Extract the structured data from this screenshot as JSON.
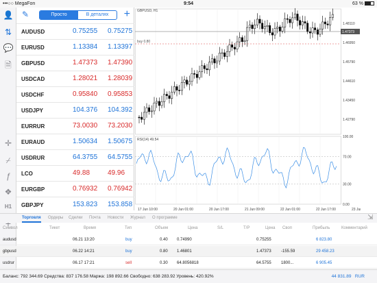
{
  "status": {
    "left": "•••○○ MegaFon",
    "time": "9:54",
    "right": "63 %"
  },
  "quotes": {
    "tabs": {
      "simple": "Просто",
      "detailed": "В деталях"
    },
    "rows": [
      {
        "sym": "AUDUSD",
        "bid": "0.75255",
        "ask": "0.75275",
        "color": "blue"
      },
      {
        "sym": "EURUSD",
        "bid": "1.13384",
        "ask": "1.13397",
        "color": "blue"
      },
      {
        "sym": "GBPUSD",
        "bid": "1.47373",
        "ask": "1.47390",
        "color": "red"
      },
      {
        "sym": "USDCAD",
        "bid": "1.28021",
        "ask": "1.28039",
        "color": "red"
      },
      {
        "sym": "USDCHF",
        "bid": "0.95840",
        "ask": "0.95853",
        "color": "red"
      },
      {
        "sym": "USDJPY",
        "bid": "104.376",
        "ask": "104.392",
        "color": "blue"
      },
      {
        "sym": "EURRUR",
        "bid": "73.0030",
        "ask": "73.2030",
        "color": "red"
      },
      {
        "sym": "EURAUD",
        "bid": "1.50634",
        "ask": "1.50675",
        "color": "blue"
      },
      {
        "sym": "USDRUR",
        "bid": "64.3755",
        "ask": "64.5755",
        "color": "blue"
      },
      {
        "sym": "LCO",
        "bid": "49.88",
        "ask": "49.96",
        "color": "red"
      },
      {
        "sym": "EURGBP",
        "bid": "0.76932",
        "ask": "0.76942",
        "color": "red"
      },
      {
        "sym": "GBPJPY",
        "bid": "153.823",
        "ask": "153.858",
        "color": "blue"
      }
    ]
  },
  "chart": {
    "title": "GBPUSD, H1",
    "order_label": "buy 0.80",
    "current_price": "1.47373",
    "rsi_label": "RSI(14) 49.54",
    "price_ticks": [
      "1.48110",
      "1.46950",
      "1.45790",
      "1.44610",
      "1.43450",
      "1.42790"
    ],
    "rsi_ticks": [
      "100.00",
      "70.00",
      "30.00",
      "0.00"
    ],
    "time_ticks": [
      "17 Jun 10:00",
      "20 Jun 01:00",
      "20 Jun 17:00",
      "21 Jun 09:00",
      "22 Jun 01:00",
      "22 Jun 17:00",
      "23 Jun 0"
    ],
    "right_label": "H1"
  },
  "chart_data": {
    "type": "candlestick",
    "title": "GBPUSD, H1",
    "ylim": [
      1.422,
      1.486
    ]
  },
  "tabs": [
    "Торговля",
    "Ордеры",
    "Сделки",
    "Почта",
    "Новости",
    "Журнал",
    "О программе"
  ],
  "table": {
    "headers": [
      "Символ",
      "Тикет",
      "Время",
      "Тип",
      "Объем",
      "Цена",
      "S/L",
      "T/P",
      "Цена",
      "Своп",
      "Прибыль",
      "Комментарий"
    ],
    "rows": [
      {
        "sym": "audusd",
        "time": "06.21 13:20",
        "type": "buy",
        "vol": "0.40",
        "price": "0.74990",
        "cur": "0.75255",
        "swap": "",
        "profit": "6 823.80"
      },
      {
        "sym": "gbpusd",
        "time": "06.22 14:21",
        "type": "buy",
        "vol": "0.80",
        "price": "1.46801",
        "cur": "1.47373",
        "swap": "-155.59",
        "profit": "29 458.23"
      },
      {
        "sym": "usdrur",
        "time": "06.17 17:21",
        "type": "sell",
        "vol": "0.30",
        "price": "64.8056818",
        "cur": "64.5755",
        "swap": "1800...",
        "profit": "6 905.45"
      }
    ]
  },
  "footer": {
    "summary": "Баланс: 792 344.69 Средства: 837 176.58 Маржа: 198 892.66 Свободно: 638 283.92 Уровень: 420.92%",
    "total": "44 831.89",
    "currency": "RUR"
  }
}
